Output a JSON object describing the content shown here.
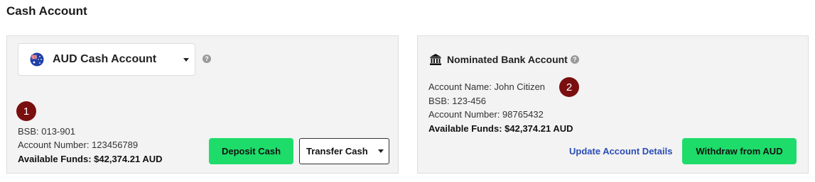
{
  "page": {
    "title": "Cash Account"
  },
  "cash_panel": {
    "account_select": {
      "label": "AUD Cash Account",
      "flag": "australia-flag-icon"
    },
    "help_icon": "?",
    "marker": "1",
    "bsb": "BSB: 013-901",
    "account_number": "Account Number: 123456789",
    "available_funds": "Available Funds: $42,374.21 AUD",
    "deposit_label": "Deposit Cash",
    "transfer_label": "Transfer Cash"
  },
  "bank_panel": {
    "heading": "Nominated Bank Account",
    "help_icon": "?",
    "marker": "2",
    "account_name": "Account Name: John Citizen",
    "bsb": "BSB: 123-456",
    "account_number": "Account Number: 98765432",
    "available_funds": "Available Funds: $42,374.21 AUD",
    "update_label": "Update Account Details",
    "withdraw_label": "Withdraw from AUD"
  },
  "colors": {
    "primary_button": "#1edc6a",
    "link": "#2a4db5",
    "marker": "#7a0f10",
    "panel_bg": "#f3f3f3"
  }
}
